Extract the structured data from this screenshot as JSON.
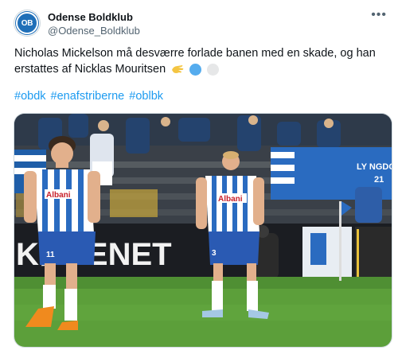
{
  "author": {
    "name": "Odense Boldklub",
    "handle": "@Odense_Boldklub",
    "avatar_text": "OB"
  },
  "tweet": {
    "text": "Nicholas Mickelson må desværre forlade banen med en skade, og han erstattes af Nicklas Mouritsen",
    "hashtags": [
      "#obdk",
      "#enafstriberne",
      "#oblbk"
    ]
  },
  "photo": {
    "boards_text": "KØBENET",
    "sponsor_left": "Albani",
    "sponsor_right": "Albani",
    "number_left": "11",
    "number_right": "3",
    "banner_text": "LY NGDO",
    "banner_text_2": "21"
  },
  "colors": {
    "link": "#1d9bf0",
    "brand_blue": "#1f6fb8"
  },
  "icons": [
    "more-icon",
    "clapping-hand-emoji",
    "blue-circle-emoji",
    "white-circle-emoji"
  ]
}
